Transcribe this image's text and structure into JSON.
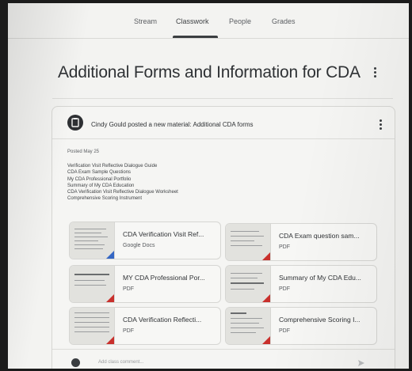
{
  "nav": {
    "tabs": [
      {
        "label": "Stream"
      },
      {
        "label": "Classwork"
      },
      {
        "label": "People"
      },
      {
        "label": "Grades"
      }
    ],
    "active_tab": "Classwork"
  },
  "page": {
    "title": "Additional Forms and Information for CDA"
  },
  "post": {
    "header": "Cindy Gould posted a new material: Additional CDA forms",
    "posted": "Posted May 25",
    "description": [
      "Verification Visit Reflective Dialogue Guide",
      "CDA Exam Sample Questions",
      "My CDA Professional Portfolio",
      "Summary of My CDA Education",
      "CDA Verification Visit Reflective Dialogue Worksheet",
      "Comprehensive Scoring Instrument"
    ],
    "attachments": [
      {
        "title": "CDA Verification Visit Ref...",
        "type": "Google Docs"
      },
      {
        "title": "CDA Exam question sam...",
        "type": "PDF"
      },
      {
        "title": "MY CDA Professional Por...",
        "type": "PDF"
      },
      {
        "title": "Summary of My CDA Edu...",
        "type": "PDF"
      },
      {
        "title": "CDA Verification Reflecti...",
        "type": "PDF"
      },
      {
        "title": "Comprehensive Scoring I...",
        "type": "PDF"
      }
    ],
    "comment_placeholder": "Add class comment..."
  },
  "icons": {
    "more": "more-vert-icon",
    "avatar": "material-icon",
    "send": "send-icon"
  },
  "colors": {
    "pdf_corner": "#c9302c",
    "docs_corner": "#3567c4"
  }
}
